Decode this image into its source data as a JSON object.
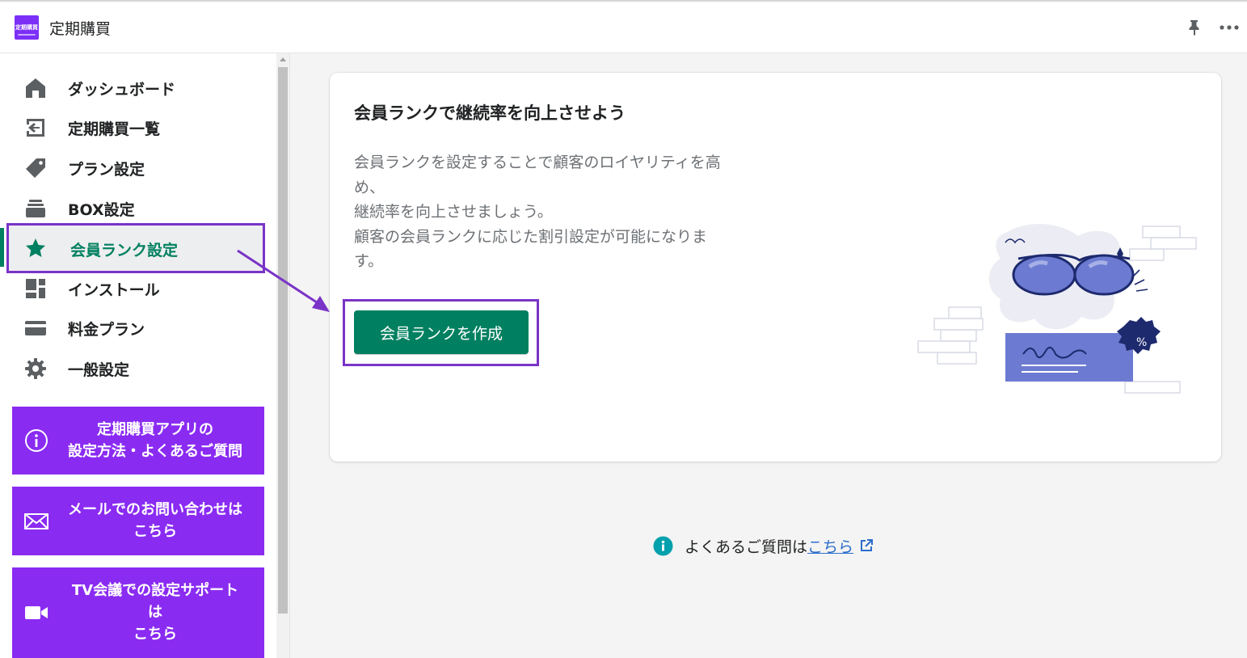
{
  "app": {
    "logo_text": "定期購買",
    "title": "定期購買"
  },
  "topbar_icons": [
    "pin-icon",
    "more-horizontal-icon"
  ],
  "sidebar": {
    "items": [
      {
        "label": "ダッシュボード",
        "icon": "home-icon"
      },
      {
        "label": "定期購買一覧",
        "icon": "import-icon"
      },
      {
        "label": "プラン設定",
        "icon": "tag-icon"
      },
      {
        "label": "BOX設定",
        "icon": "stack-icon"
      },
      {
        "label": "会員ランク設定",
        "icon": "star-icon",
        "active": true
      },
      {
        "label": "インストール",
        "icon": "layout-icon"
      },
      {
        "label": "料金プラン",
        "icon": "credit-card-icon"
      },
      {
        "label": "一般設定",
        "icon": "gear-icon"
      }
    ],
    "promos": [
      {
        "text": "定期購買アプリの\n設定方法・よくあるご質問",
        "icon": "info-icon"
      },
      {
        "text": "メールでのお問い合わせは\nこちら",
        "icon": "mail-icon"
      },
      {
        "text": "TV会議での設定サポート\nは\nこちら",
        "icon": "video-icon"
      }
    ]
  },
  "card": {
    "title": "会員ランクで継続率を向上させよう",
    "description": "会員ランクを設定することで顧客のロイヤリティを高\nめ、\n継続率を向上させましょう。\n顧客の会員ランクに応じた割引設定が可能になりま\nす。",
    "cta_label": "会員ランクを作成"
  },
  "help": {
    "text": "よくあるご質問は",
    "link_text": "こちら"
  },
  "colors": {
    "accent_green": "#008060",
    "promo_purple": "#8a2bf2",
    "annotation_purple": "#7a33c7",
    "link_blue": "#2c6ecb",
    "info_teal": "#00a0ac"
  }
}
